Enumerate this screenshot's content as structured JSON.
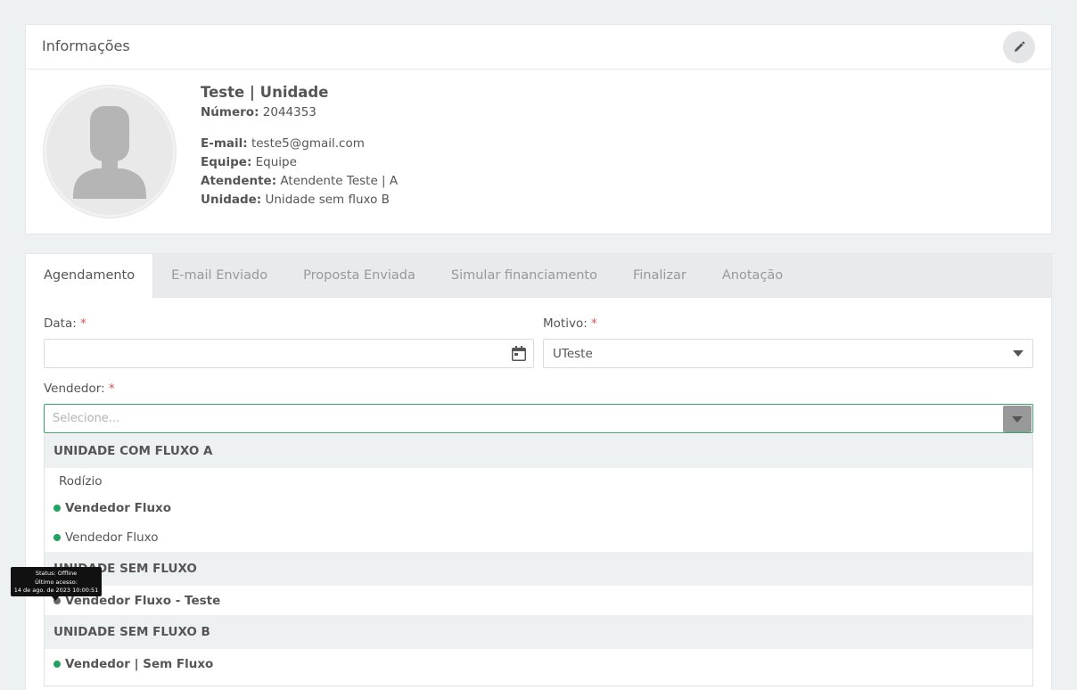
{
  "info_card": {
    "title": "Informações",
    "edit_icon": "pencil-icon",
    "avatar_icon": "user-silhouette-icon",
    "name": "Teste | Unidade",
    "fields": [
      {
        "label": "Número:",
        "value": "2044353"
      },
      {
        "label": "E-mail:",
        "value": "teste5@gmail.com"
      },
      {
        "label": "Equipe:",
        "value": "Equipe"
      },
      {
        "label": "Atendente:",
        "value": "Atendente Teste | A"
      },
      {
        "label": "Unidade:",
        "value": "Unidade sem fluxo B"
      }
    ]
  },
  "tabs": [
    {
      "label": "Agendamento",
      "active": true
    },
    {
      "label": "E-mail Enviado",
      "active": false
    },
    {
      "label": "Proposta Enviada",
      "active": false
    },
    {
      "label": "Simular financiamento",
      "active": false
    },
    {
      "label": "Finalizar",
      "active": false
    },
    {
      "label": "Anotação",
      "active": false
    }
  ],
  "form": {
    "data_label": "Data:",
    "data_value": "",
    "motivo_label": "Motivo:",
    "motivo_value": "UTeste",
    "vendedor_label": "Vendedor:",
    "vendedor_placeholder": "Selecione...",
    "required_mark": "*"
  },
  "dropdown": {
    "group1": "UNIDADE COM FLUXO A",
    "group1_options": [
      "Rodízio",
      "Vendedor Fluxo",
      "Vendedor Fluxo"
    ],
    "group2": "UNIDADE SEM FLUXO",
    "group2_options": [
      "Vendedor Fluxo - Teste"
    ],
    "group3": "UNIDADE SEM FLUXO B",
    "group3_options": [
      "Vendedor | Sem Fluxo"
    ]
  },
  "tooltip": {
    "line1": "Status: Offline",
    "line2": "Último acesso:",
    "line3": "14 de ago. de 2023 10:00:51"
  },
  "colors": {
    "online": "#21a35f",
    "offline": "#666666",
    "required": "#d9534f",
    "focus_border": "#3aa56b"
  }
}
